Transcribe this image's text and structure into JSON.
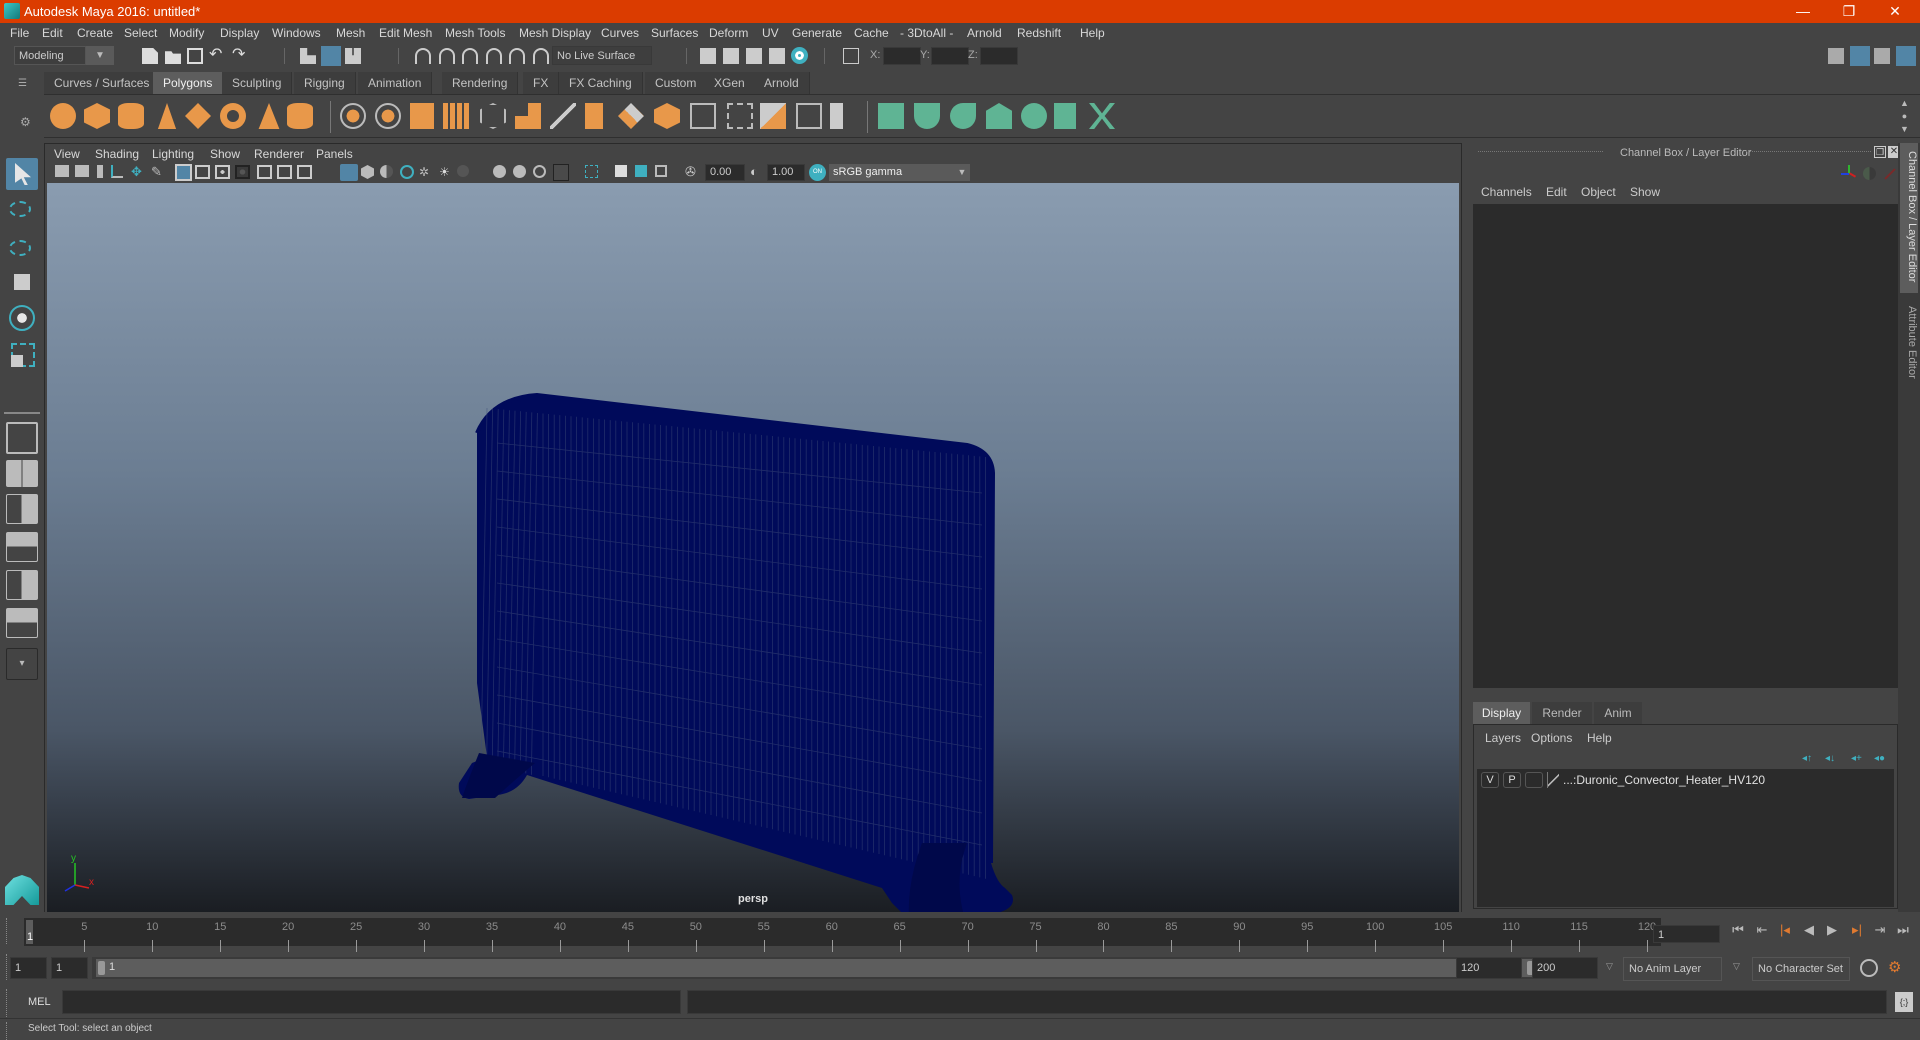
{
  "window": {
    "title": "Autodesk Maya 2016: untitled*",
    "controls": {
      "minimize": "—",
      "restore": "❐",
      "close": "✕"
    },
    "accent_color": "#db3c00"
  },
  "menubar": [
    "File",
    "Edit",
    "Create",
    "Select",
    "Modify",
    "Display",
    "Windows",
    "Mesh",
    "Edit Mesh",
    "Mesh Tools",
    "Mesh Display",
    "Curves",
    "Surfaces",
    "Deform",
    "UV",
    "Generate",
    "Cache",
    "- 3DtoAll -",
    "Arnold",
    "Redshift",
    "Help"
  ],
  "statusline": {
    "mode": "Modeling",
    "live_surface": "No Live Surface",
    "x_label": "X:",
    "y_label": "Y:",
    "z_label": "Z:",
    "x_value": "",
    "y_value": "",
    "z_value": ""
  },
  "shelf": {
    "tabs": [
      "Curves / Surfaces",
      "Polygons",
      "Sculpting",
      "Rigging",
      "Animation",
      "Rendering",
      "FX",
      "FX Caching",
      "Custom",
      "XGen",
      "Arnold"
    ],
    "active_tab": "Polygons",
    "icons": [
      "poly-sphere-icon",
      "poly-cube-icon",
      "poly-cylinder-icon",
      "poly-cone-icon",
      "poly-plane-icon",
      "poly-torus-icon",
      "poly-pyramid-icon",
      "poly-pipe-icon",
      "combine-icon",
      "separate-icon",
      "mirror-icon",
      "smooth-icon",
      "extract-icon",
      "booleans-icon",
      "reduce-icon",
      "multi-cut-icon",
      "bevel-icon",
      "bridge-icon",
      "extrude-icon",
      "insert-edge-loop-icon",
      "fill-hole-icon",
      "append-polygon-icon",
      "target-weld-icon",
      "merge-icon",
      "uv-planar-icon",
      "uv-cylindrical-icon",
      "uv-spherical-icon",
      "uv-auto-icon",
      "uv-unfold-icon",
      "uv-editor-icon",
      "uv-layout-icon"
    ]
  },
  "panel": {
    "menus": [
      "View",
      "Shading",
      "Lighting",
      "Show",
      "Renderer",
      "Panels"
    ],
    "exposure": "0.00",
    "gamma": "1.00",
    "color_space": "sRGB gamma",
    "camera_label": "persp",
    "axis": {
      "x": "x",
      "y": "y",
      "z": "z"
    }
  },
  "scene": {
    "object": "Duronic_Convector_Heater_HV120",
    "wire_color": "#000a5a"
  },
  "channel_box": {
    "title": "Channel Box / Layer Editor",
    "menus": [
      "Channels",
      "Edit",
      "Object",
      "Show"
    ]
  },
  "layer_editor": {
    "tabs": [
      "Display",
      "Render",
      "Anim"
    ],
    "active_tab": "Display",
    "menus": [
      "Layers",
      "Options",
      "Help"
    ],
    "layers": [
      {
        "visible": "V",
        "playback": "P",
        "name": "...:Duronic_Convector_Heater_HV120"
      }
    ]
  },
  "side_tabs": [
    "Channel Box / Layer Editor",
    "Attribute Editor"
  ],
  "timeline": {
    "start": 1,
    "end": 120,
    "ticks": [
      5,
      10,
      15,
      20,
      25,
      30,
      35,
      40,
      45,
      50,
      55,
      60,
      65,
      70,
      75,
      80,
      85,
      90,
      95,
      100,
      105,
      110,
      115,
      120
    ],
    "current_frame_marker": "1",
    "current_frame": "1"
  },
  "range": {
    "start_frame": "1",
    "playback_start": "1",
    "slider_start": "1",
    "slider_end": "120",
    "playback_end": "120",
    "end_frame": "200",
    "anim_layer": "No Anim Layer",
    "character_set": "No Character Set"
  },
  "command_line": {
    "label": "MEL",
    "value": "",
    "result": ""
  },
  "help_line": "Select Tool: select an object"
}
